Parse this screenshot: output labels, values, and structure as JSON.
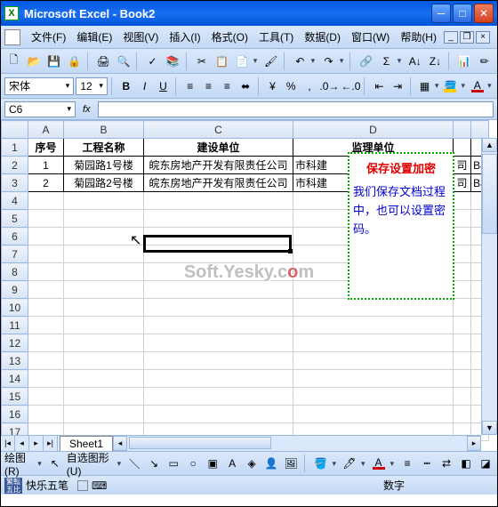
{
  "window": {
    "title": "Microsoft Excel - Book2"
  },
  "menus": [
    "文件(F)",
    "编辑(E)",
    "视图(V)",
    "插入(I)",
    "格式(O)",
    "工具(T)",
    "数据(D)",
    "窗口(W)",
    "帮助(H)"
  ],
  "font": {
    "name": "宋体",
    "size": "12"
  },
  "namebox": "C6",
  "fx_label": "fx",
  "columns": [
    "A",
    "B",
    "C",
    "D"
  ],
  "row_numbers": [
    "1",
    "2",
    "3",
    "4",
    "5",
    "6",
    "7",
    "8",
    "9",
    "10",
    "11",
    "12",
    "13",
    "14",
    "15",
    "16",
    "17"
  ],
  "headers": {
    "A": "序号",
    "B": "工程名称",
    "C": "建设单位",
    "D": "监理单位"
  },
  "rows": [
    {
      "A": "1",
      "B": "菊园路1号楼",
      "C": "皖东房地产开发有限责任公司",
      "D": "市科建",
      "E": "司",
      "F": "Ba"
    },
    {
      "A": "2",
      "B": "菊园路2号楼",
      "C": "皖东房地产开发有限责任公司",
      "D": "市科建",
      "E": "司",
      "F": "Ba"
    }
  ],
  "sheet_tab": "Sheet1",
  "drawbar": {
    "drawing": "绘图(R)",
    "autoshapes": "自选图形(U)"
  },
  "statusbar": {
    "ime": "快乐五笔",
    "right": "数字"
  },
  "callout": {
    "title": "保存设置加密",
    "body": "我们保存文档过程中，也可以设置密码。"
  },
  "watermark": {
    "left": "Soft.Yesky.c",
    "mid": "o",
    "right": "m"
  }
}
